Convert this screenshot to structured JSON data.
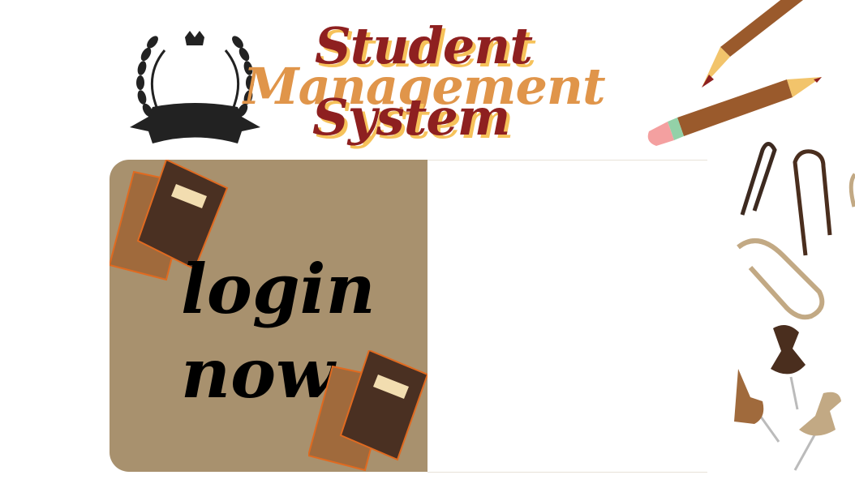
{
  "header": {
    "title_line1": "Student",
    "title_line2": "Management",
    "title_line3": "System"
  },
  "login_panel": {
    "line1": "login",
    "line2": "now"
  },
  "colors": {
    "title_red": "#8e2020",
    "title_orange": "#e0954a",
    "panel_brown": "#a8916e"
  }
}
